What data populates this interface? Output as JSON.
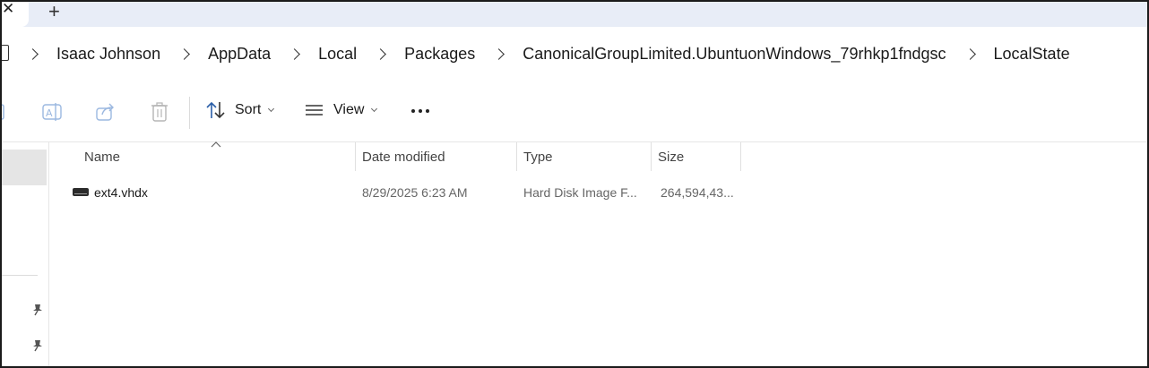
{
  "tabs": {
    "close_glyph": "✕",
    "new_tab_glyph": "+"
  },
  "breadcrumb": [
    "Isaac Johnson",
    "AppData",
    "Local",
    "Packages",
    "CanonicalGroupLimited.UbuntuonWindows_79rhkp1fndgsc",
    "LocalState"
  ],
  "toolbar": {
    "sort_label": "Sort",
    "view_label": "View",
    "icons": [
      "rename-icon",
      "share-icon",
      "delete-icon",
      "sort-icon",
      "view-icon",
      "more-icon"
    ]
  },
  "columns": {
    "name": "Name",
    "date": "Date modified",
    "type": "Type",
    "size": "Size"
  },
  "files": [
    {
      "name": "ext4.vhdx",
      "date": "8/29/2025 6:23 AM",
      "type": "Hard Disk Image F...",
      "size": "264,594,43..."
    }
  ],
  "colors": {
    "tabstrip": "#e8edf7",
    "selection": "#e5e5e5",
    "accent": "#2b5fa8"
  }
}
